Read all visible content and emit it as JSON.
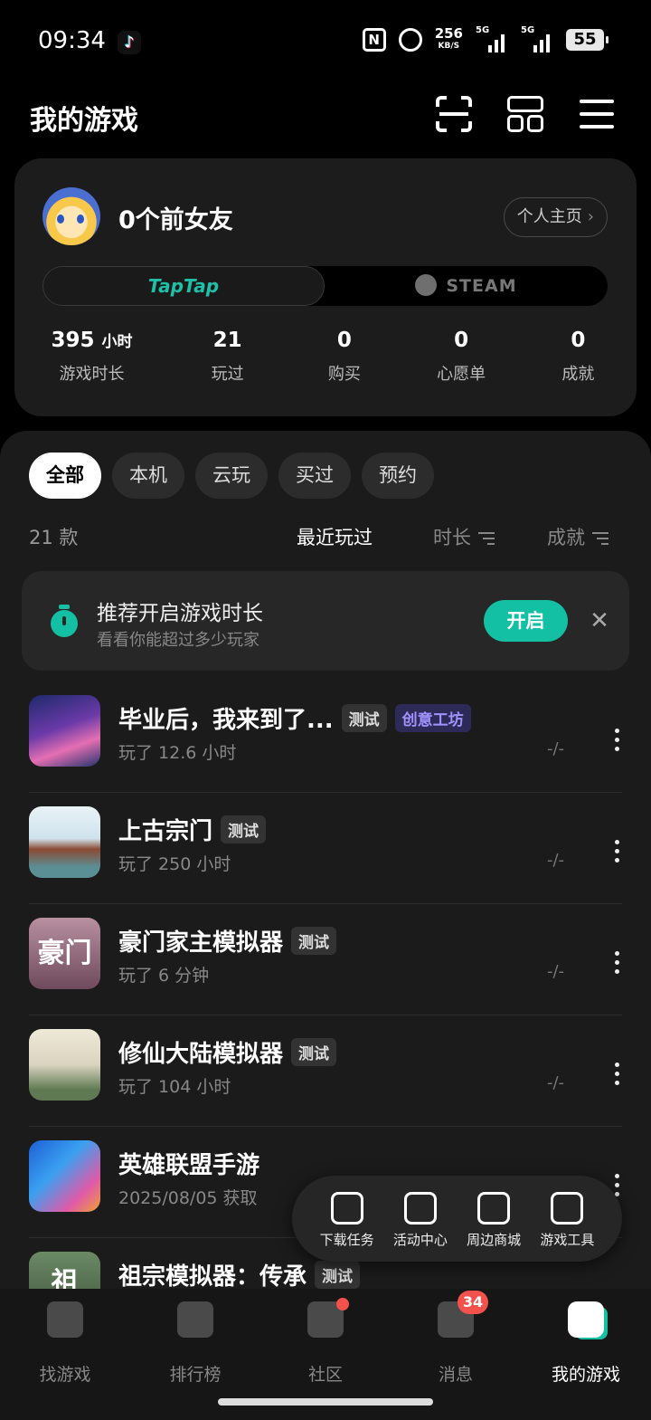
{
  "status_bar": {
    "time": "09:34",
    "speed_value": "256",
    "speed_unit": "KB/S",
    "sim1": "5G",
    "sim2": "5G",
    "battery": "55"
  },
  "header": {
    "title": "我的游戏"
  },
  "profile": {
    "username": "0个前女友",
    "homepage_label": "个人主页",
    "platform_active": "TapTap",
    "platform_other": "STEAM",
    "stats": [
      {
        "value": "395",
        "unit": "小时",
        "label": "游戏时长"
      },
      {
        "value": "21",
        "unit": "",
        "label": "玩过"
      },
      {
        "value": "0",
        "unit": "",
        "label": "购买"
      },
      {
        "value": "0",
        "unit": "",
        "label": "心愿单"
      },
      {
        "value": "0",
        "unit": "",
        "label": "成就"
      }
    ]
  },
  "filters": [
    "全部",
    "本机",
    "云玩",
    "买过",
    "预约"
  ],
  "sortbar": {
    "count": "21 款",
    "recent": "最近玩过",
    "duration": "时长",
    "achievement": "成就"
  },
  "recommend": {
    "title": "推荐开启游戏时长",
    "subtitle": "看看你能超过多少玩家",
    "button": "开启"
  },
  "games": [
    {
      "name": "毕业后，我来到了...",
      "tags": [
        "测试",
        "创意工坊"
      ],
      "sub": "玩了 12.6 小时",
      "ach": "-/-"
    },
    {
      "name": "上古宗门",
      "tags": [
        "测试"
      ],
      "sub": "玩了 250 小时",
      "ach": "-/-"
    },
    {
      "name": "豪门家主模拟器",
      "tags": [
        "测试"
      ],
      "sub": "玩了 6 分钟",
      "ach": "-/-",
      "thumb_text": "豪门"
    },
    {
      "name": "修仙大陆模拟器",
      "tags": [
        "测试"
      ],
      "sub": "玩了 104 小时",
      "ach": "-/-"
    },
    {
      "name": "英雄联盟手游",
      "tags": [],
      "sub": "2025/08/05 获取",
      "ach": ""
    },
    {
      "name": "祖宗模拟器：传承",
      "tags": [
        "测试"
      ],
      "sub": "",
      "ach": "",
      "thumb_text": "祖"
    }
  ],
  "toolbox": [
    "下载任务",
    "活动中心",
    "周边商城",
    "游戏工具"
  ],
  "bottom_nav": [
    {
      "label": "找游戏"
    },
    {
      "label": "排行榜"
    },
    {
      "label": "社区"
    },
    {
      "label": "消息",
      "badge": "34"
    },
    {
      "label": "我的游戏"
    }
  ],
  "colors": {
    "accent": "#14c0a4",
    "badge_red": "#f2524b",
    "purple_tag": "#a193ff"
  }
}
